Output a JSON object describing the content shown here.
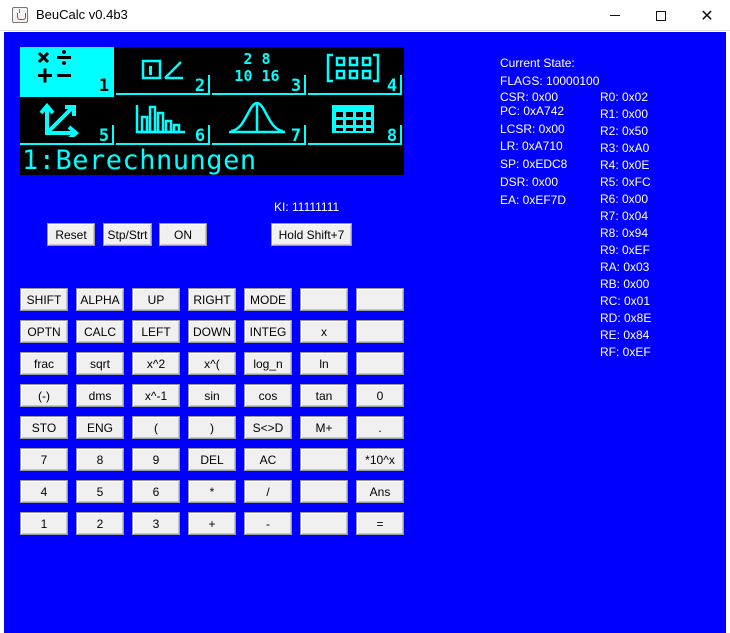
{
  "window": {
    "title": "BeuCalc v0.4b3",
    "min_glyph": "",
    "close_glyph": "✕"
  },
  "lcd": {
    "status_line": "1:Berechnungen",
    "menu": [
      {
        "num": "1",
        "icon": "calculation-icon",
        "glyph": "✖➗\n✚▬",
        "selected": true
      },
      {
        "num": "2",
        "icon": "statistics-icon",
        "glyph": "",
        "selected": false
      },
      {
        "num": "3",
        "icon": "base-n-icon",
        "glyph": "",
        "selected": false
      },
      {
        "num": "4",
        "icon": "matrix-icon",
        "glyph": "",
        "selected": false
      },
      {
        "num": "5",
        "icon": "vector-icon",
        "glyph": "",
        "selected": false
      },
      {
        "num": "6",
        "icon": "bar-chart-icon",
        "glyph": "",
        "selected": false
      },
      {
        "num": "7",
        "icon": "distribution-icon",
        "glyph": "",
        "selected": false
      },
      {
        "num": "8",
        "icon": "spreadsheet-icon",
        "glyph": "",
        "selected": false
      }
    ],
    "base_n_text": {
      "top": "2 8",
      "bottom": "10 16"
    }
  },
  "ki": "KI: 11111111",
  "controls": {
    "reset": "Reset",
    "stop_start": "Stp/Strt",
    "on": "ON",
    "hold_shift": "Hold Shift+7"
  },
  "keypad": [
    [
      "SHIFT",
      "ALPHA",
      "UP",
      "RIGHT",
      "MODE",
      "",
      ""
    ],
    [
      "OPTN",
      "CALC",
      "LEFT",
      "DOWN",
      "INTEG",
      "x",
      ""
    ],
    [
      "frac",
      "sqrt",
      "x^2",
      "x^(",
      "log_n",
      "ln",
      ""
    ],
    [
      "(-)",
      "dms",
      "x^-1",
      "sin",
      "cos",
      "tan",
      "0"
    ],
    [
      "STO",
      "ENG",
      "(",
      ")",
      "S<>D",
      "M+",
      "."
    ],
    [
      "7",
      "8",
      "9",
      "DEL",
      "AC",
      "",
      "*10^x"
    ],
    [
      "4",
      "5",
      "6",
      "*",
      "/",
      "",
      "Ans"
    ],
    [
      "1",
      "2",
      "3",
      "+",
      "-",
      "",
      "="
    ]
  ],
  "state": {
    "heading": "Current State:",
    "flags": "FLAGS: 10000100",
    "left": [
      "CSR: 0x00",
      "PC: 0xA742",
      "LCSR: 0x00",
      "LR: 0xA710",
      "SP: 0xEDC8",
      "DSR: 0x00",
      "EA: 0xEF7D"
    ],
    "registers": [
      "R0: 0x02",
      "R1: 0x00",
      "R2: 0x50",
      "R3: 0xA0",
      "R4: 0x0E",
      "R5: 0xFC",
      "R6: 0x00",
      "R7: 0x04",
      "R8: 0x94",
      "R9: 0xEF",
      "RA: 0x03",
      "RB: 0x00",
      "RC: 0x01",
      "RD: 0x8E",
      "RE: 0x84",
      "RF: 0xEF"
    ]
  },
  "colors": {
    "background": "#0000ff",
    "lcd_bg": "#000000",
    "lcd_fg": "#00ffff",
    "button": "#f0f0f0",
    "text_on_blue": "#ffffff"
  }
}
